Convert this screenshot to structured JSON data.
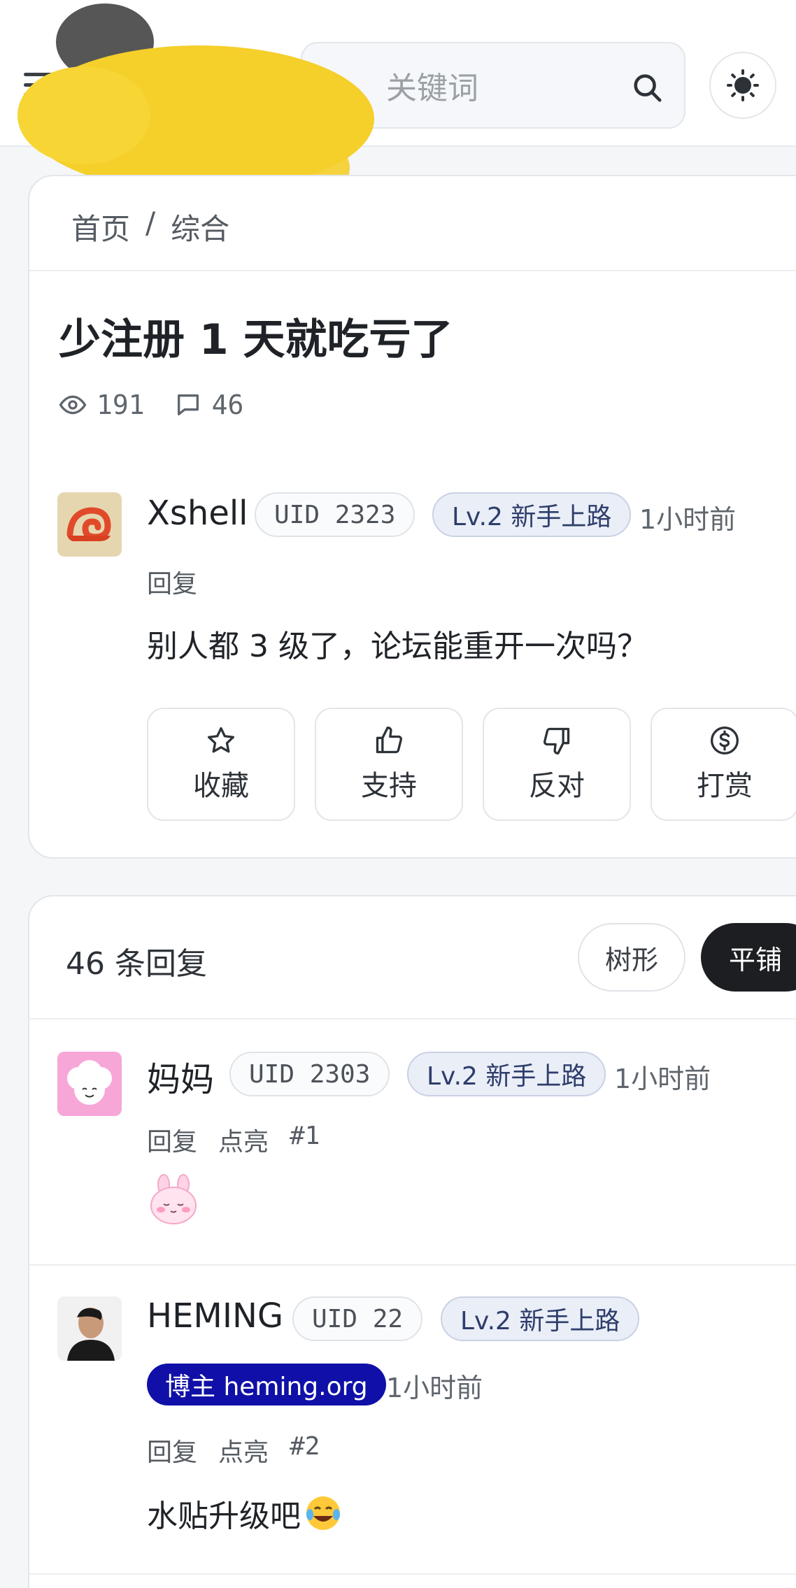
{
  "header": {
    "search_placeholder": "关键词",
    "icons": [
      "menu-icon",
      "search-icon",
      "sun-icon"
    ]
  },
  "breadcrumb": {
    "home": "首页",
    "separator": "/",
    "section": "综合"
  },
  "post": {
    "title": "少注册 1 天就吃亏了",
    "views": "191",
    "comments": "46",
    "author": {
      "name": "Xshell",
      "uid": "UID 2323",
      "level": "Lv.2 新手上路",
      "time": "1小时前",
      "reply_label": "回复"
    },
    "content": "别人都 3 级了，论坛能重开一次吗？",
    "actions": [
      {
        "label": "收藏",
        "icon": "star-icon"
      },
      {
        "label": "支持",
        "icon": "thumbs-up-icon"
      },
      {
        "label": "反对",
        "icon": "thumbs-down-icon"
      },
      {
        "label": "打赏",
        "icon": "dollar-coin-icon"
      }
    ]
  },
  "replies_section": {
    "count_label": "46 条回复",
    "view_tree": "树形",
    "view_flat": "平铺",
    "replies": [
      {
        "name": "妈妈",
        "uid": "UID 2303",
        "level": "Lv.2 新手上路",
        "time": "1小时前",
        "reply": "回复",
        "like": "点亮",
        "floor": "#1",
        "content_emoji": "bunny-sticker"
      },
      {
        "name": "HEMING",
        "uid": "UID 22",
        "level": "Lv.2 新手上路",
        "badge": "博主 heming.org",
        "time": "1小时前",
        "reply": "回复",
        "like": "点亮",
        "floor": "#2",
        "content": "水贴升级吧"
      }
    ]
  },
  "colors": {
    "accent_dark": "#1c1e21",
    "blogger_badge": "#1010a8",
    "level_badge_bg": "#eaeef7"
  }
}
